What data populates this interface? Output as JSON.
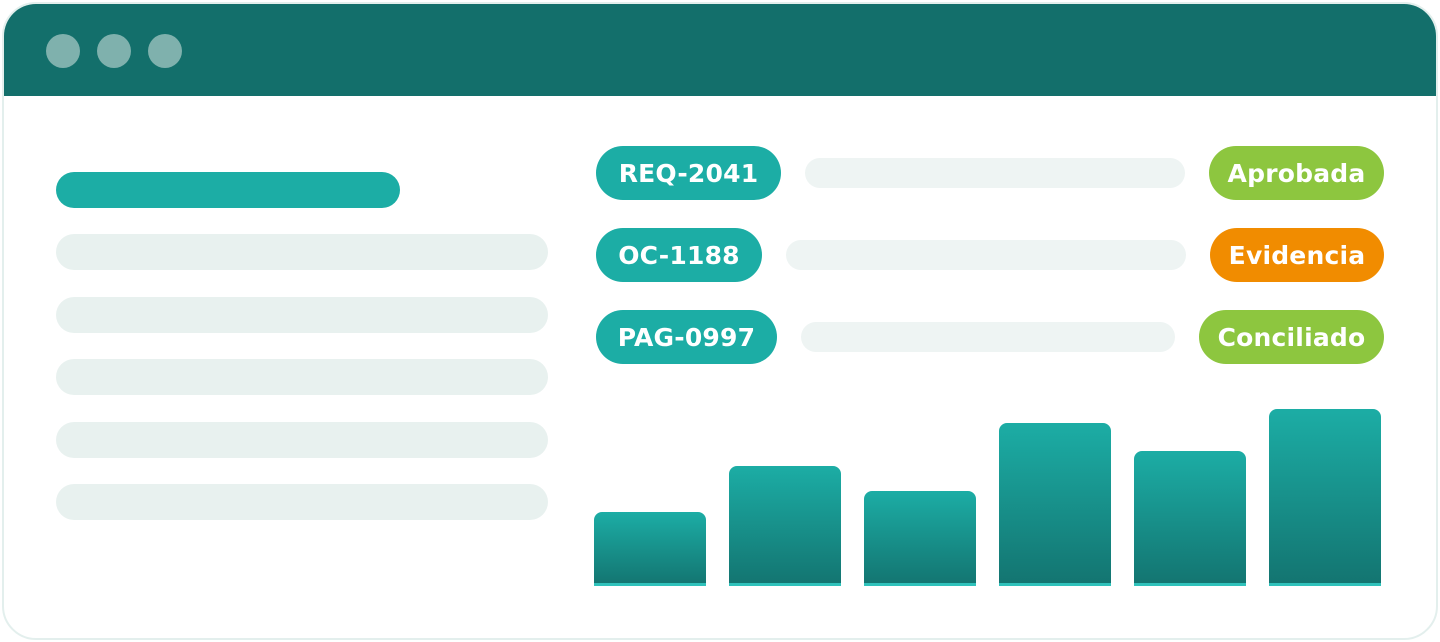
{
  "rows": [
    {
      "id": "REQ-2041",
      "status": "Aprobada",
      "status_color": "#8dc63f"
    },
    {
      "id": "OC-1188",
      "status": "Evidencia",
      "status_color": "#f18c00"
    },
    {
      "id": "PAG-0997",
      "status": "Conciliado",
      "status_color": "#8dc63f"
    }
  ],
  "colors": {
    "titlebar": "#136f6b",
    "accent": "#1cada5",
    "placeholder": "#e8f1ef"
  },
  "chart_data": {
    "type": "bar",
    "categories": [
      "",
      "",
      "",
      "",
      "",
      ""
    ],
    "values": [
      39,
      63,
      50,
      86,
      71,
      93
    ],
    "ylim": [
      0,
      100
    ]
  }
}
